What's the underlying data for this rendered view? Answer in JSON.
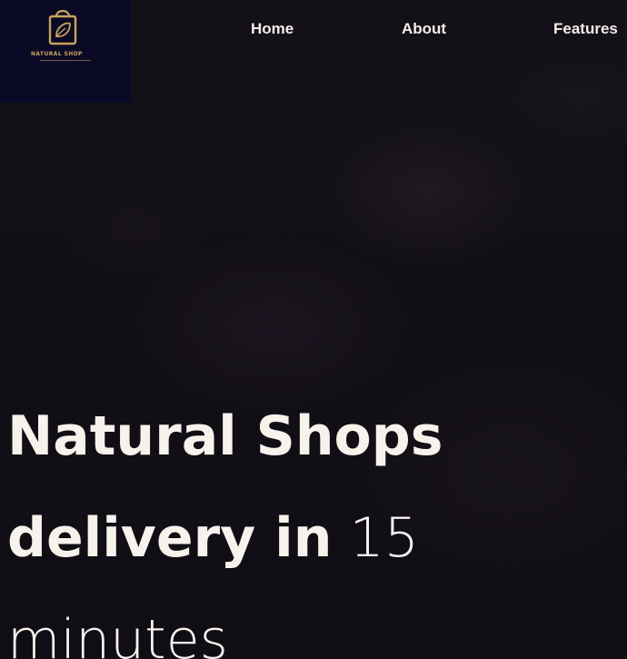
{
  "brand": {
    "name": "NATURAL SHOP",
    "icon": "shopping-bag-leaf-icon",
    "accent_color": "#c9a35c",
    "logo_background": "#0b0a26"
  },
  "nav": {
    "items": [
      {
        "label": "Home"
      },
      {
        "label": "About"
      },
      {
        "label": "Features"
      }
    ]
  },
  "hero": {
    "headline_bold_1": "Natural Shops",
    "headline_bold_2": "delivery in",
    "headline_light_1": "15",
    "headline_light_2": "minutes"
  },
  "colors": {
    "background": "#130f17",
    "text": "#f6f2ec"
  }
}
